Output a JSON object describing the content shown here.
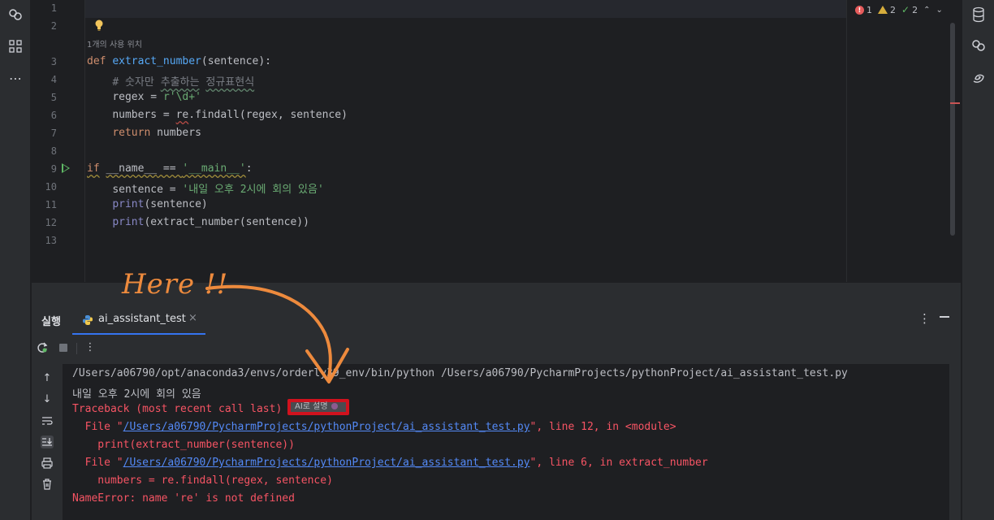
{
  "editor": {
    "line_numbers": [
      "1",
      "2",
      "3",
      "4",
      "5",
      "6",
      "7",
      "8",
      "9",
      "10",
      "11",
      "12",
      "13"
    ],
    "usage_hint": "1개의 사용 위치",
    "code": {
      "l3_kw": "def",
      "l3_fn": "extract_number",
      "l3_rest": "(sentence):",
      "l4_comment_a": "# 숫자만 ",
      "l4_comment_b": "추출하는",
      "l4_comment_c": " ",
      "l4_comment_d": "정규표현식",
      "l5_lhs": "regex = ",
      "l5_str": "r'\\d+'",
      "l6_lhs": "numbers = ",
      "l6_re": "re",
      "l6_rest": ".findall(regex, sentence)",
      "l7_kw": "return",
      "l7_rest": " numbers",
      "l9_kw": "if",
      "l9_name": "__name__",
      "l9_eq": " == ",
      "l9_str": "'__main__'",
      "l9_colon": ":",
      "l10_lhs": "sentence = ",
      "l10_str": "'내일 오후 2시에 회의 있음'",
      "l11_fn": "print",
      "l11_rest": "(sentence)",
      "l12_fn": "print",
      "l12_rest": "(extract_number(sentence))"
    }
  },
  "inspection": {
    "errors": "1",
    "warnings": "2",
    "ok": "2"
  },
  "run_panel": {
    "title": "실행",
    "tab_label": "ai_assistant_test",
    "tab_close": "×",
    "menu": "⋮"
  },
  "console": {
    "cmd": "/Users/a06790/opt/anaconda3/envs/orderly39_env/bin/python /Users/a06790/PycharmProjects/pythonProject/ai_assistant_test.py",
    "out1": "내일 오후 2시에 회의 있음",
    "tb_head": "Traceback (most recent call last)",
    "ai_button": "AI로 설명",
    "file1_pre": "  File \"",
    "file1_path": "/Users/a06790/PycharmProjects/pythonProject/ai_assistant_test.py",
    "file1_post": "\", line 12, in <module>",
    "code1": "    print(extract_number(sentence))",
    "file2_pre": "  File \"",
    "file2_path": "/Users/a06790/PycharmProjects/pythonProject/ai_assistant_test.py",
    "file2_post": "\", line 6, in extract_number",
    "code2": "    numbers = re.findall(regex, sentence)",
    "error": "NameError: name 're' is not defined"
  },
  "annotation": {
    "text": "Here !!"
  },
  "colors": {
    "accent": "#3574f0",
    "error_red": "#f75464",
    "highlight_box": "#d0121e",
    "annotation_orange": "#ed8a3d"
  }
}
